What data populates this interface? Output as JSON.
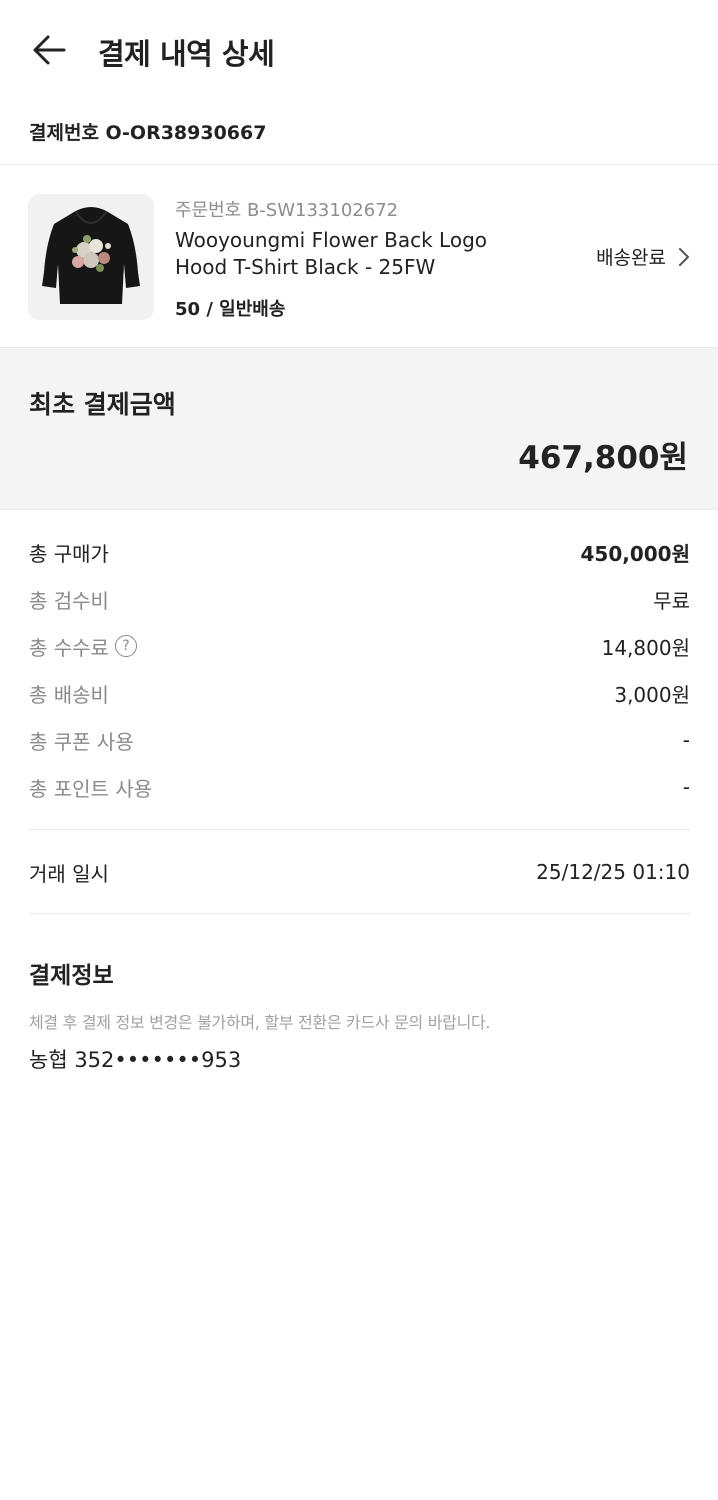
{
  "header": {
    "title": "결제 내역 상세",
    "back_icon": "arrow-left-icon"
  },
  "payment_number": "결제번호 O-OR38930667",
  "order": {
    "order_number": "주문번호 B-SW133102672",
    "product_name": "Wooyoungmi Flower Back Logo Hood T-Shirt Black - 25FW",
    "option": "50 / 일반배송",
    "status": "배송완료",
    "status_icon": "chevron-right-icon"
  },
  "summary": {
    "title": "최초 결제금액",
    "amount": "467,800원"
  },
  "costs": [
    {
      "label": "총 구매가",
      "value": "450,000원"
    },
    {
      "label": "총 검수비",
      "value": "무료"
    },
    {
      "label": "총 수수료",
      "value": "14,800원"
    },
    {
      "label": "총 배송비",
      "value": "3,000원"
    },
    {
      "label": "총 쿠폰 사용",
      "value": "-"
    },
    {
      "label": "총 포인트 사용",
      "value": "-"
    }
  ],
  "transaction": {
    "label": "거래 일시",
    "value": "25/12/25 01:10"
  },
  "payment_info": {
    "title": "결제정보",
    "note": "체결 후 결제 정보 변경은 불가하며, 할부 전환은 카드사 문의 바랍니다.",
    "card": "농협 352•••••••953"
  },
  "colors": {
    "text": "#222222",
    "muted": "#8a8a8a",
    "note": "#a2a2a2",
    "divider": "#e9e9e9",
    "summary_bg": "#f4f4f4"
  }
}
